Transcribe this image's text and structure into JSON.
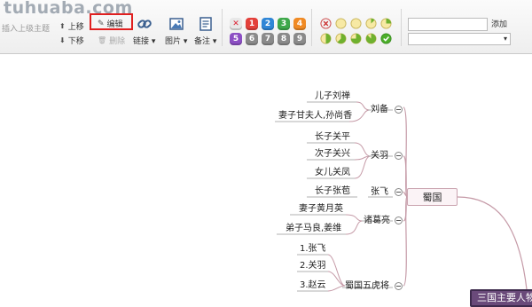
{
  "watermark": "tuhuaba.com",
  "toolbar": {
    "insert_parent_label": "插入上级主题",
    "move_up_label": "上移",
    "move_down_label": "下移",
    "edit_label": "编辑",
    "delete_label": "删除",
    "link_label": "链接",
    "image_label": "图片",
    "note_label": "备注",
    "priority": {
      "row1": [
        {
          "text": "✕",
          "color": "#e8e8e8",
          "fg": "#d23"
        },
        {
          "text": "1",
          "color": "#e3403a",
          "fg": "#fff"
        },
        {
          "text": "2",
          "color": "#2f86d6",
          "fg": "#fff"
        },
        {
          "text": "3",
          "color": "#3ea84a",
          "fg": "#fff"
        },
        {
          "text": "4",
          "color": "#f08a24",
          "fg": "#fff"
        }
      ],
      "row2": [
        {
          "text": "5",
          "color": "#8c4fc4",
          "fg": "#fff"
        },
        {
          "text": "6",
          "color": "#8a8a8a",
          "fg": "#fff"
        },
        {
          "text": "7",
          "color": "#8a8a8a",
          "fg": "#fff"
        },
        {
          "text": "8",
          "color": "#8a8a8a",
          "fg": "#fff"
        },
        {
          "text": "9",
          "color": "#8a8a8a",
          "fg": "#fff"
        }
      ]
    },
    "progress": {
      "row1": [
        0,
        0,
        0.125,
        0.25
      ],
      "row2": [
        0.5,
        0.625,
        0.75,
        0.875,
        1
      ]
    },
    "add_label": "添加",
    "tag_input_value": "",
    "tag_select_value": ""
  },
  "mindmap": {
    "shu_label": "蜀国",
    "root_label": "三国主要人物",
    "liubei": {
      "label": "刘备",
      "children": [
        "儿子刘禅",
        "妻子甘夫人,孙尚香"
      ]
    },
    "guanyu": {
      "label": "关羽",
      "children": [
        "长子关平",
        "次子关兴",
        "女儿关凤"
      ]
    },
    "zhangfei": {
      "label": "张飞",
      "children": [
        "长子张苞"
      ]
    },
    "zhuge": {
      "label": "诸葛亮",
      "children": [
        "妻子黄月英",
        "弟子马良,姜维"
      ]
    },
    "wuhu": {
      "label": "蜀国五虎将",
      "children": [
        "1.张飞",
        "2.关羽",
        "3.赵云"
      ]
    }
  },
  "colors": {
    "branch_line": "#c59aa7",
    "underline": "#b0b0b0",
    "root_fill": "#6a4a7a",
    "highlight_box": "#e02020"
  }
}
